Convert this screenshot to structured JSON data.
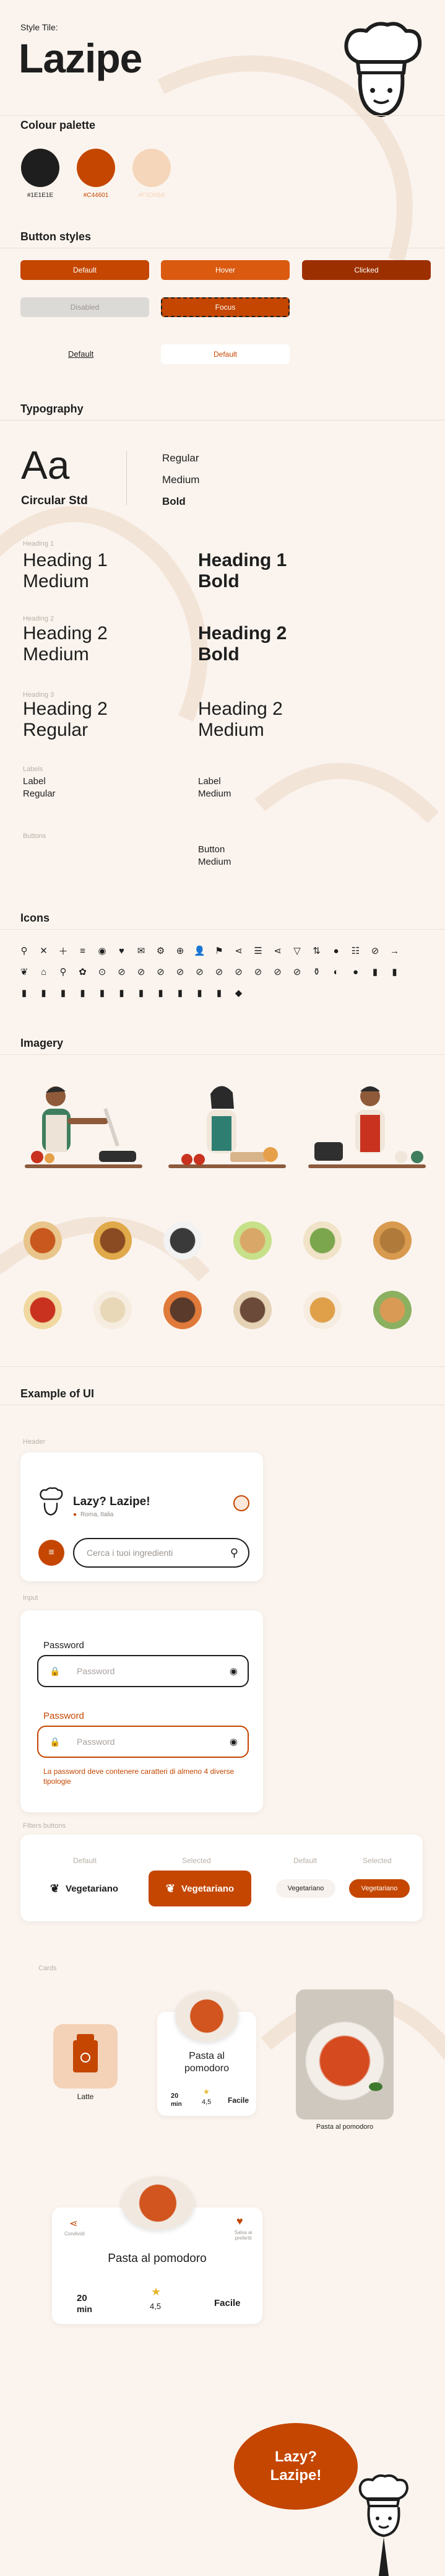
{
  "header": {
    "style_tile_label": "Style Tile:",
    "brand": "Lazipe"
  },
  "colour_palette": {
    "title": "Colour palette",
    "swatches": [
      {
        "label": "#1E1E1E",
        "color": "#1E1E1E"
      },
      {
        "label": "#C44601",
        "color": "#C44601"
      },
      {
        "label": "#F5D6BA",
        "color": "#F5D6BA"
      }
    ]
  },
  "buttons": {
    "title": "Button styles",
    "default": "Default",
    "hover": "Hover",
    "clicked": "Clicked",
    "disabled": "Disabled",
    "focus": "Focus",
    "link_default": "Default",
    "outline_default": "Default"
  },
  "typography": {
    "title": "Typography",
    "sample": "Aa",
    "font_name": "Circular Std",
    "weights": [
      "Regular",
      "Medium",
      "Bold"
    ],
    "h1_label": "Heading 1",
    "h1_medium": "Heading 1 Medium",
    "h1_bold": "Heading 1 Bold",
    "h2_label": "Heading 2",
    "h2_medium": "Heading 2 Medium",
    "h2_bold": "Heading 2 Bold",
    "h3_label": "Heading 3",
    "h3_regular": "Heading 2 Regular",
    "h3_medium": "Heading 2 Medium",
    "labels_label": "Labels",
    "label_regular": "Label Regular",
    "label_medium": "Label Medium",
    "buttons_label": "Buttons",
    "button_medium": "Button Medium"
  },
  "icons": {
    "title": "Icons"
  },
  "imagery": {
    "title": "Imagery"
  },
  "example": {
    "title": "Example of UI",
    "header_label": "Header",
    "app_title": "Lazy? Lazipe!",
    "location": "Roma, Italia",
    "search_placeholder": "Cerca i tuoi ingredienti",
    "input_label": "Input",
    "password_label": "Password",
    "password_placeholder": "Password",
    "error_text": "La password deve contenere caratteri di almeno 4 diverse tipologie",
    "filters_label": "Filters buttons",
    "filter_default": "Default",
    "filter_selected": "Selected",
    "vegetarian": "Vegetariano",
    "cards_label": "Cards",
    "latte": "Latte",
    "pasta": "Pasta al pomodoro",
    "minutes_value": "20",
    "minutes_unit": "min",
    "rating": "4,5",
    "difficulty": "Facile",
    "share": "Condividi",
    "save": "Salva ai preferiti"
  },
  "mascot": {
    "bubble": "Lazy? Lazipe!"
  }
}
